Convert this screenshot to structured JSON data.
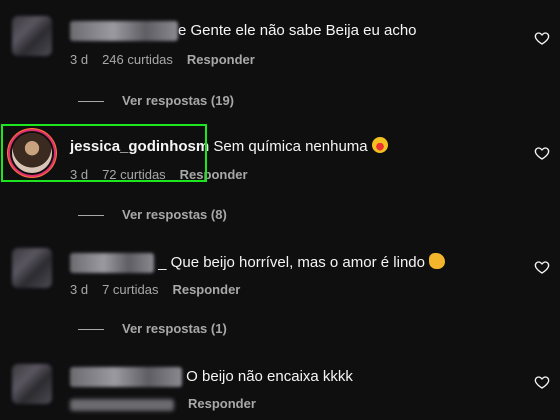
{
  "comments": [
    {
      "text": "e Gente ele não sabe Beija eu acho",
      "time": "3 d",
      "likes": "246 curtidas",
      "reply": "Responder",
      "view_replies": "Ver respostas (19)"
    },
    {
      "username": "jessica_godinhosm",
      "text": "Sem química nenhuma",
      "emoji": "laughing-emoji",
      "time": "3 d",
      "likes": "72 curtidas",
      "reply": "Responder",
      "view_replies": "Ver respostas (8)"
    },
    {
      "text": "_ Que beijo horrível, mas o amor é lindo",
      "emoji": "clapping-emoji",
      "time": "3 d",
      "likes": "7 curtidas",
      "reply": "Responder",
      "view_replies": "Ver respostas (1)"
    },
    {
      "text": "O beijo não encaixa kkkk",
      "reply": "Responder"
    }
  ],
  "colors": {
    "background": "#0f0f10",
    "highlight": "#1ee61e",
    "muted": "#a8a8a8"
  }
}
